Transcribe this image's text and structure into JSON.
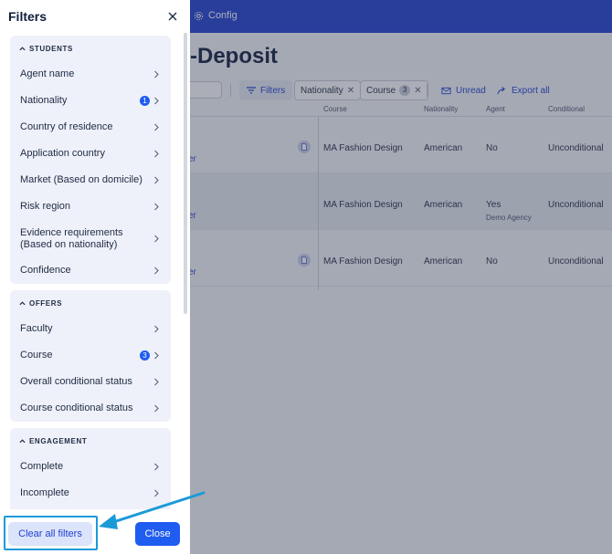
{
  "app": {
    "topbar": {
      "config_label": "Config"
    },
    "page_title": "-Deposit",
    "toolbar": {
      "filters_label": "Filters",
      "chips": [
        {
          "label": "Nationality",
          "count": ""
        },
        {
          "label": "Course",
          "count": "3"
        }
      ],
      "unread_label": "Unread",
      "export_label": "Export all"
    },
    "table": {
      "columns": [
        "Course",
        "Nationality",
        "Agent",
        "Conditional"
      ],
      "rows": [
        {
          "student_suffix": "er",
          "course": "MA Fashion Design",
          "nationality": "American",
          "agent": "No",
          "agent_sub": "",
          "conditional": "Unconditional"
        },
        {
          "student_suffix": "er",
          "course": "MA Fashion Design",
          "nationality": "American",
          "agent": "Yes",
          "agent_sub": "Demo Agency",
          "conditional": "Unconditional"
        },
        {
          "student_suffix": "er",
          "course": "MA Fashion Design",
          "nationality": "American",
          "agent": "No",
          "agent_sub": "",
          "conditional": "Unconditional"
        }
      ]
    }
  },
  "drawer": {
    "title": "Filters",
    "sections": [
      {
        "title": "STUDENTS",
        "items": [
          {
            "label": "Agent name",
            "badge": ""
          },
          {
            "label": "Nationality",
            "badge": "1"
          },
          {
            "label": "Country of residence",
            "badge": ""
          },
          {
            "label": "Application country",
            "badge": ""
          },
          {
            "label": "Market (Based on domicile)",
            "badge": ""
          },
          {
            "label": "Risk region",
            "badge": ""
          },
          {
            "label": "Evidence requirements (Based on nationality)",
            "badge": ""
          },
          {
            "label": "Confidence",
            "badge": ""
          }
        ]
      },
      {
        "title": "OFFERS",
        "items": [
          {
            "label": "Faculty",
            "badge": ""
          },
          {
            "label": "Course",
            "badge": "3"
          },
          {
            "label": "Overall conditional status",
            "badge": ""
          },
          {
            "label": "Course conditional status",
            "badge": ""
          }
        ]
      },
      {
        "title": "ENGAGEMENT",
        "items": [
          {
            "label": "Complete",
            "badge": ""
          },
          {
            "label": "Incomplete",
            "badge": ""
          }
        ]
      }
    ],
    "footer": {
      "clear_label": "Clear all filters",
      "close_label": "Close"
    }
  },
  "colors": {
    "brand": "#1f3fd1",
    "primary_button": "#1f5cf0",
    "annotation": "#1b9ad8"
  }
}
